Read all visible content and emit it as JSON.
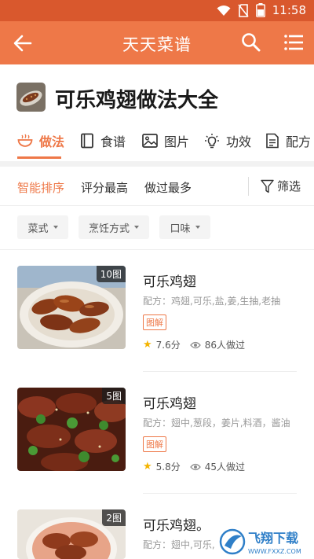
{
  "status_bar": {
    "time": "11:58"
  },
  "app_bar": {
    "title": "天天菜谱"
  },
  "header": {
    "title": "可乐鸡翅做法大全"
  },
  "tabs": [
    {
      "label": "做法",
      "icon": "bowl-icon",
      "active": true
    },
    {
      "label": "食谱",
      "icon": "book-icon",
      "active": false
    },
    {
      "label": "图片",
      "icon": "image-icon",
      "active": false
    },
    {
      "label": "功效",
      "icon": "bulb-icon",
      "active": false
    },
    {
      "label": "配方",
      "icon": "document-icon",
      "active": false
    }
  ],
  "sort": {
    "options": [
      "智能排序",
      "评分最高",
      "做过最多"
    ],
    "active_index": 0,
    "filter_label": "筛选"
  },
  "filters": [
    "菜式",
    "烹饪方式",
    "口味"
  ],
  "recipes": [
    {
      "title": "可乐鸡翅",
      "badge": "10图",
      "ingredients": "配方：鸡翅,可乐,盐,姜,生抽,老抽",
      "tag": "图解",
      "rating": "7.6分",
      "views": "86人做过"
    },
    {
      "title": "可乐鸡翅",
      "badge": "5图",
      "ingredients": "配方：翅中,葱段，姜片,料酒，酱油",
      "tag": "图解",
      "rating": "5.8分",
      "views": "45人做过"
    },
    {
      "title": "可乐鸡翅。",
      "badge": "2图",
      "ingredients": "配方：翅中,可乐,",
      "tag": "",
      "rating": "",
      "views": ""
    }
  ],
  "watermark": {
    "text": "飞翔下载",
    "url": "WWW.FXXZ.COM"
  },
  "colors": {
    "accent": "#ee7848",
    "status_bar": "#d9582d",
    "star": "#f4b400"
  }
}
